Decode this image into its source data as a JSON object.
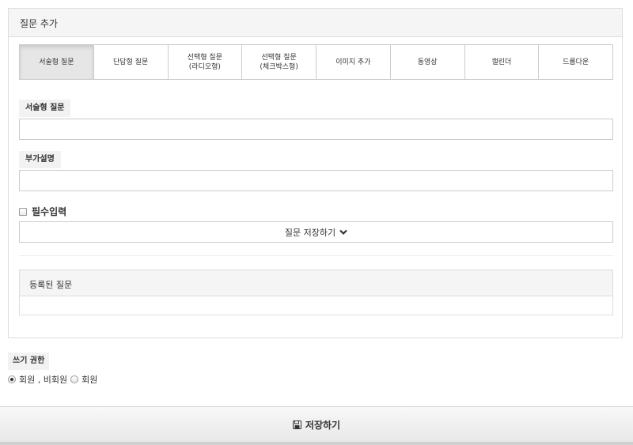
{
  "panel": {
    "title": "질문 추가"
  },
  "question_types": [
    {
      "label": "서술형 질문",
      "active": true
    },
    {
      "label": "단답형 질문",
      "active": false
    },
    {
      "label": "선택형 질문\n(라디오형)",
      "active": false
    },
    {
      "label": "선택형 질문\n(체크박스형)",
      "active": false
    },
    {
      "label": "이미지 추가",
      "active": false
    },
    {
      "label": "동영상",
      "active": false
    },
    {
      "label": "캘린더",
      "active": false
    },
    {
      "label": "드롭다운",
      "active": false
    }
  ],
  "form": {
    "question_label": "서술형 질문",
    "question_value": "",
    "description_label": "부가설명",
    "description_value": "",
    "required_label": "필수입력",
    "required_checked": false,
    "save_question_label": "질문 저장하기"
  },
  "registered": {
    "title": "등록된 질문"
  },
  "permission": {
    "label": "쓰기 권한",
    "options": [
      {
        "label": "회원 , 비회원",
        "checked": true
      },
      {
        "label": "회원",
        "checked": false
      }
    ]
  },
  "footer": {
    "save_label": "저장하기"
  },
  "icons": {
    "chevron": "chevron-down-icon",
    "save": "floppy-disk-icon"
  }
}
